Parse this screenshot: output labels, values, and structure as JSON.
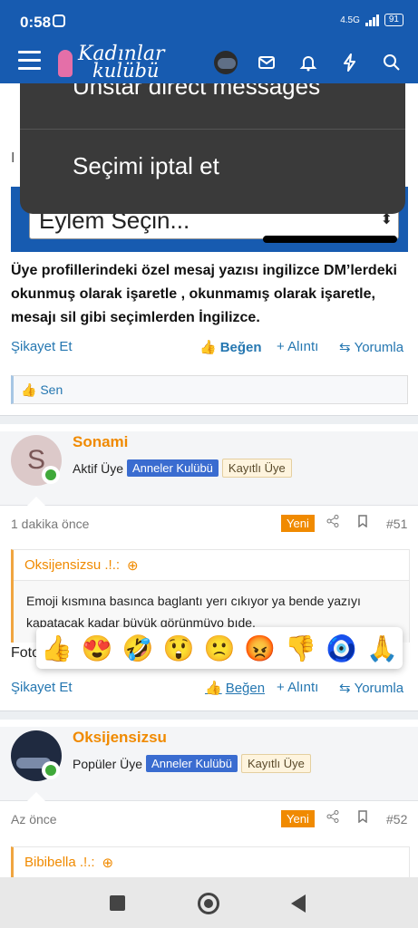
{
  "status": {
    "time": "0:58",
    "network": "4.5G",
    "battery": "91"
  },
  "app": {
    "logo_line1": "Kadınlar",
    "logo_line2": "kulübü"
  },
  "menu": {
    "item1": "Unstar direct messages",
    "item2": "Seçimi iptal et"
  },
  "fragment": {
    "text": "I"
  },
  "screenshot": {
    "select_label": "Eylem Seçin...",
    "select_arrow": "⬍"
  },
  "post1": {
    "body": "Üye profillerindeki özel mesaj yazısı ingilizce DM’lerdeki okunmuş olarak işaretle , okunmamış olarak işaretle, mesajı sil gibi seçimlerden İngilizce.",
    "report": "Şikayet Et",
    "like": "Beğen",
    "quote": "+ Alıntı",
    "reply": "Yorumla",
    "reaction_by": "Sen"
  },
  "post2": {
    "avatar_letter": "S",
    "username": "Sonami",
    "rank": "Aktif Üye",
    "badge1": "Anneler Kulübü",
    "badge2": "Kayıtlı Üye",
    "time": "1 dakika önce",
    "new": "Yeni",
    "number": "#51",
    "quote_author": "Oksijensizsu .!.:",
    "quote_text": "Emoji kısmına basınca baglantı yerı cıkıyor ya bende yazıyı kapatacak kadar büyük görünmüyo bıde.",
    "body": "Foto",
    "report": "Şikayet Et",
    "like": "Beğen",
    "quote": "+ Alıntı",
    "reply": "Yorumla"
  },
  "emojis": [
    "👍",
    "😍",
    "🤣",
    "😲",
    "🙁",
    "😡",
    "👎",
    "🧿",
    "🙏"
  ],
  "post3": {
    "username": "Oksijensizsu",
    "rank": "Popüler Üye",
    "badge1": "Anneler Kulübü",
    "badge2": "Kayıtlı Üye",
    "time": "Az önce",
    "new": "Yeni",
    "number": "#52",
    "quote_author": "Bibibella .!.:"
  },
  "colors": {
    "brand": "#175bb0",
    "accent": "#f08a00",
    "link": "#2577b1"
  }
}
